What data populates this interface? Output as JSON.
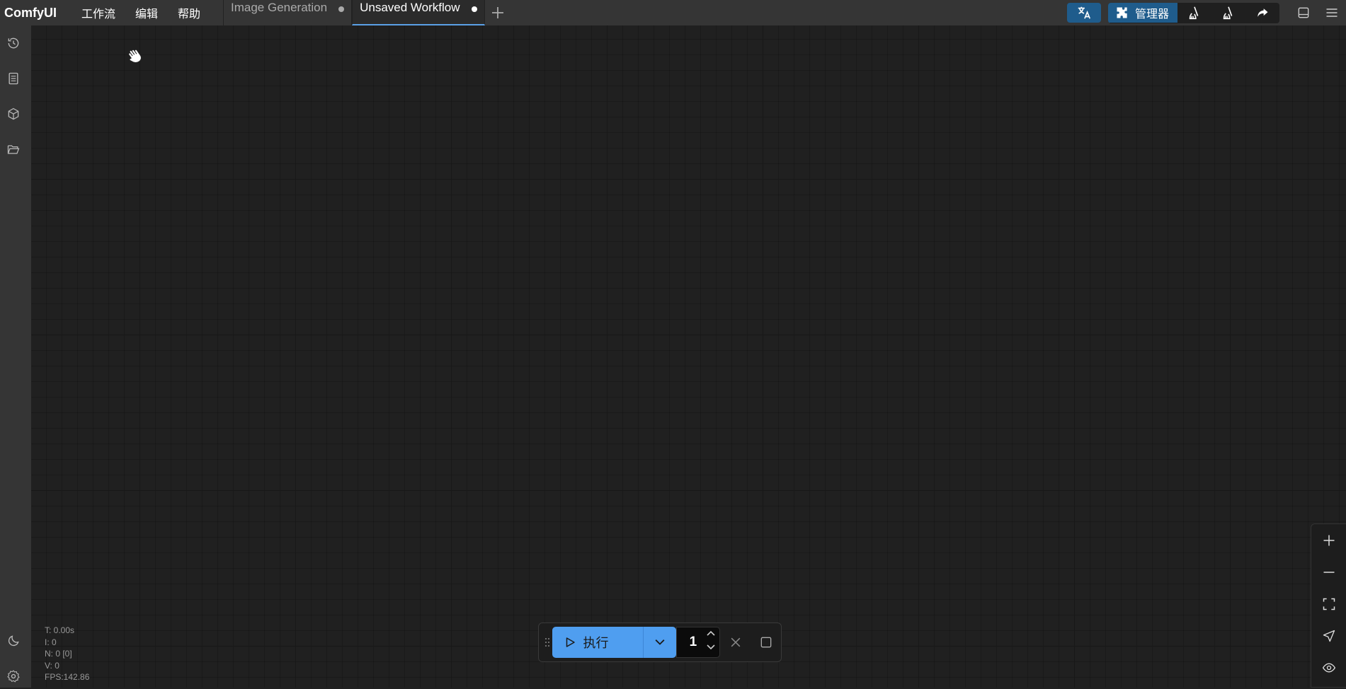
{
  "app": {
    "title": "ComfyUI"
  },
  "menu": {
    "items": [
      "工作流",
      "编辑",
      "帮助"
    ]
  },
  "tabs": [
    {
      "label": "Image Generation",
      "active": false
    },
    {
      "label": "Unsaved Workflow",
      "active": true
    }
  ],
  "toolbar": {
    "manager_label": "管理器"
  },
  "sidebar": {
    "icons": [
      "history-icon",
      "document-icon",
      "cube-icon",
      "folder-open-icon",
      "moon-icon",
      "gear-icon"
    ]
  },
  "stats": {
    "t": "T: 0.00s",
    "i": "I: 0",
    "n": "N: 0 [0]",
    "v": "V: 0",
    "fps": "FPS:142.86"
  },
  "runbar": {
    "run_label": "执行",
    "count": "1"
  },
  "zoom_controls": [
    "plus-icon",
    "minus-icon",
    "fit-view-icon",
    "locate-icon",
    "eye-icon"
  ],
  "colors": {
    "accent": "#4f9ef0",
    "manager_bg": "#1f5c8c",
    "topbar": "#353535",
    "canvas": "#202020"
  }
}
